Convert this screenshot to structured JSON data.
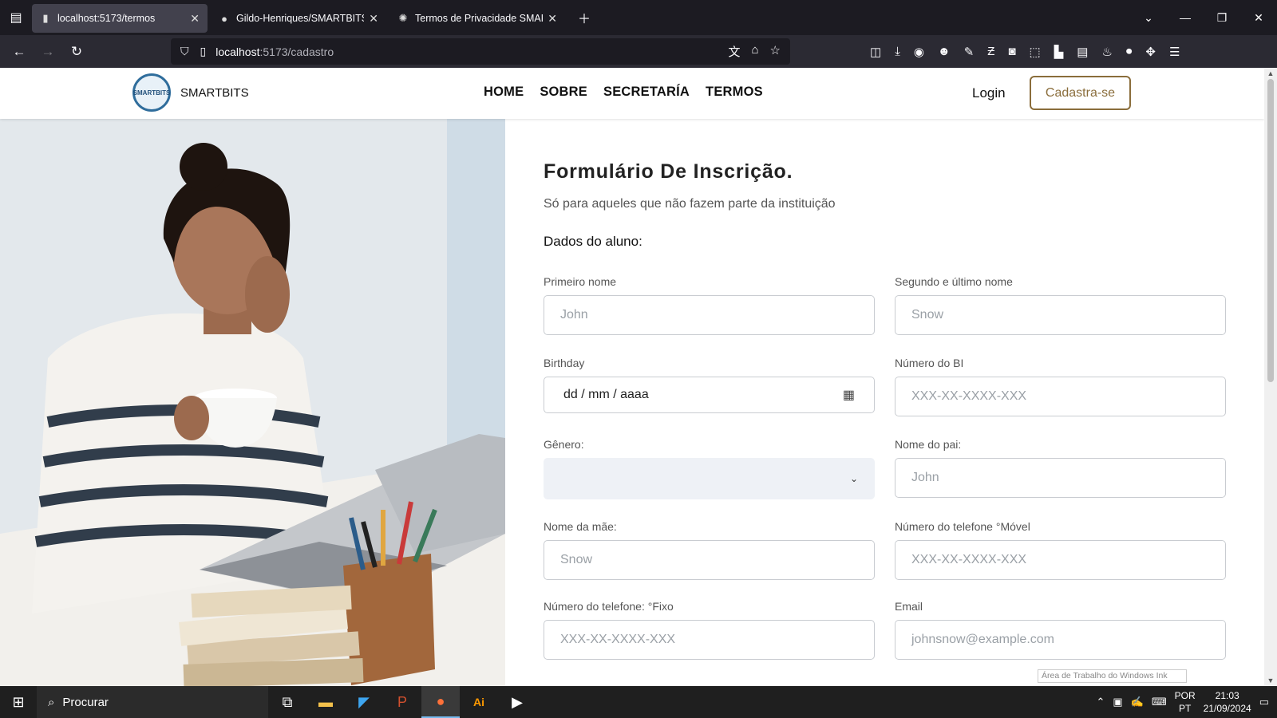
{
  "browser": {
    "tabs": [
      {
        "title": "localhost:5173/termos",
        "icon": "page-icon"
      },
      {
        "title": "Gildo-Henriques/SMARTBITS: P",
        "icon": "github-icon"
      },
      {
        "title": "Termos de Privacidade SMARTB",
        "icon": "openai-icon"
      }
    ],
    "url_host": "localhost",
    "url_path": ":5173/cadastro"
  },
  "site": {
    "brand": "SMARTBITS",
    "logo_text": "SMARTBITS",
    "menu": [
      "HOME",
      "SOBRE",
      "SECRETARÍA",
      "TERMOS"
    ],
    "login": "Login",
    "signup": "Cadastra-se"
  },
  "form": {
    "title": "Formulário De Inscrição.",
    "subtitle": "Só para aqueles que não fazem parte da instituição",
    "section": "Dados do aluno:",
    "first_name": {
      "label": "Primeiro nome",
      "placeholder": "John"
    },
    "last_name": {
      "label": "Segundo e último nome",
      "placeholder": "Snow"
    },
    "birthday": {
      "label": "Birthday",
      "value": "dd / mm / aaaa"
    },
    "bi": {
      "label": "Número do BI",
      "placeholder": "XXX-XX-XXXX-XXX"
    },
    "gender": {
      "label": "Gênero:",
      "value": ""
    },
    "father": {
      "label": "Nome do pai:",
      "placeholder": "John"
    },
    "mother": {
      "label": "Nome da mãe:",
      "placeholder": "Snow"
    },
    "mobile": {
      "label": "Número do telefone °Móvel",
      "placeholder": "XXX-XX-XXXX-XXX"
    },
    "landline": {
      "label": "Número do telefone: °Fixo",
      "placeholder": "XXX-XX-XXXX-XXX"
    },
    "email": {
      "label": "Email",
      "placeholder": "johnsnow@example.com"
    }
  },
  "tooltip": "Área de Trabalho do Windows Ink",
  "taskbar": {
    "search": "Procurar",
    "lang_top": "POR",
    "lang_bottom": "PT",
    "time": "21:03",
    "date": "21/09/2024"
  }
}
